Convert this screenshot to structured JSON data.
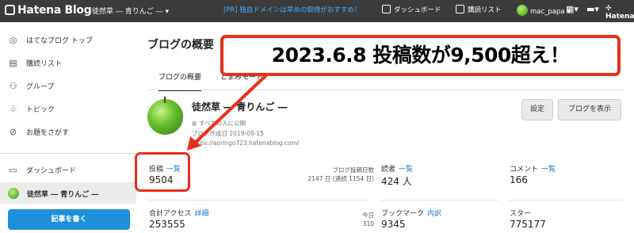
{
  "topbar": {
    "logo": "Hatena Blog",
    "blog_selector": "徒然草 ― 青りんご ―",
    "promo": "[PR] 独自ドメインは早めの取得がおすすめ！",
    "dashboard": "ダッシュボード",
    "reading_list": "購読リスト",
    "user": "mac_papa",
    "brand": "Hatena"
  },
  "sidebar": {
    "items": [
      {
        "label": "はてなブログ トップ",
        "icon": "hatena-top-icon"
      },
      {
        "label": "購読リスト",
        "icon": "reading-list-icon"
      },
      {
        "label": "グループ",
        "icon": "group-icon"
      },
      {
        "label": "トピック",
        "icon": "topic-icon"
      },
      {
        "label": "お題をさがす",
        "icon": "theme-search-icon"
      }
    ],
    "dashboard": "ダッシュボード",
    "active_blog": "徒然草 ― 青りんご ―",
    "write_button": "記事を書く"
  },
  "main": {
    "title": "ブログの概要",
    "tabs": [
      "ブログの概要",
      "とまみモード"
    ],
    "banner": "2023.6.8 投稿数が9,500超え！",
    "blog": {
      "name": "徒然草 ― 青りんご ―",
      "visibility": "すべての人に公開",
      "created": "ブログ作成日 2019-09-15",
      "url": "https://aoringo723.hatenablog.com/"
    },
    "buttons": {
      "settings": "設定",
      "view_blog": "ブログを表示"
    },
    "stats": {
      "posts": {
        "label": "投稿",
        "link": "一覧",
        "value": "9504"
      },
      "post_days": {
        "label": "ブログ投稿日数",
        "value": "2147 日 (連続 1154 日)"
      },
      "readers": {
        "label": "読者",
        "link": "一覧",
        "value": "424 人"
      },
      "comments": {
        "label": "コメント",
        "link": "一覧",
        "value": "166"
      },
      "access": {
        "label": "合計アクセス",
        "link": "詳細",
        "value": "253555",
        "today_label": "今日",
        "today_value": "310"
      },
      "bookmarks": {
        "label": "ブックマーク",
        "link": "内訳",
        "value": "9345"
      },
      "stars": {
        "label": "スター",
        "value": "775177"
      }
    },
    "accent_red": "#e83019",
    "accent_blue": "#1e90dc"
  }
}
